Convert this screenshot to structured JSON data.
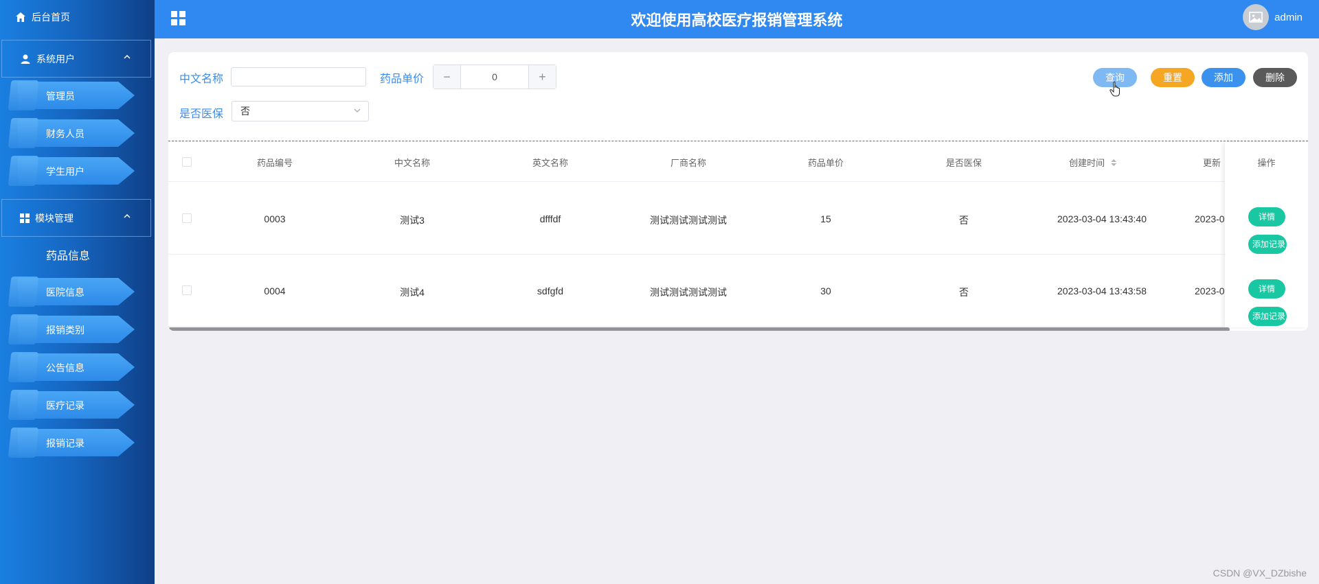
{
  "app": {
    "title": "欢迎使用高校医疗报销管理系统",
    "user": "admin"
  },
  "sidebar": {
    "home": "后台首页",
    "groups": [
      {
        "label": "系统用户",
        "items": [
          "管理员",
          "财务人员",
          "学生用户"
        ]
      },
      {
        "label": "模块管理",
        "active_item": "药品信息",
        "items": [
          "医院信息",
          "报销类别",
          "公告信息",
          "医疗记录",
          "报销记录"
        ]
      }
    ]
  },
  "search": {
    "name_label": "中文名称",
    "name_value": "",
    "price_label": "药品单价",
    "price_value": "0",
    "minus": "−",
    "plus": "+",
    "insurance_label": "是否医保",
    "insurance_value": "否"
  },
  "actions": {
    "query": "查询",
    "reset": "重置",
    "add": "添加",
    "delete": "删除"
  },
  "table": {
    "columns": [
      "药品编号",
      "中文名称",
      "英文名称",
      "厂商名称",
      "药品单价",
      "是否医保",
      "创建时间",
      "更新"
    ],
    "operation_header": "操作",
    "rows": [
      {
        "id": "0003",
        "cn": "测试3",
        "en": "dfffdf",
        "maker": "测试测试测试测试",
        "price": "15",
        "insurance": "否",
        "created": "2023-03-04 13:43:40",
        "updated": "2023-0"
      },
      {
        "id": "0004",
        "cn": "测试4",
        "en": "sdfgfd",
        "maker": "测试测试测试测试",
        "price": "30",
        "insurance": "否",
        "created": "2023-03-04 13:43:58",
        "updated": "2023-0"
      }
    ],
    "row_actions": {
      "detail": "详情",
      "add_record": "添加记录"
    }
  },
  "watermark": "CSDN @VX_DZbishe",
  "colors": {
    "primary": "#2f89f1",
    "reset": "#f5a623",
    "delete": "#5a5a5a",
    "teal": "#19c8a3"
  }
}
